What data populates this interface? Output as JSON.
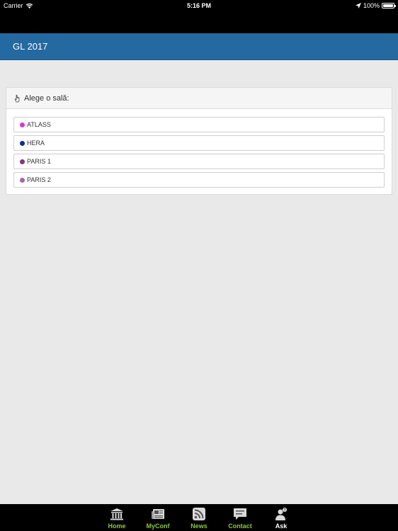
{
  "status_bar": {
    "carrier": "Carrier",
    "time": "5:16 PM",
    "battery": "100%",
    "battery_level": 1.0
  },
  "header": {
    "title": "GL 2017"
  },
  "panel": {
    "prompt": "Alege o sală:",
    "rooms": [
      {
        "label": "ATLASS",
        "color": "#d638d6"
      },
      {
        "label": "HERA",
        "color": "#142c8a"
      },
      {
        "label": "PARIS 1",
        "color": "#7b3a7f"
      },
      {
        "label": "PARIS 2",
        "color": "#a764a8"
      }
    ]
  },
  "tabs": [
    {
      "label": "Home",
      "icon": "bank-icon"
    },
    {
      "label": "MyConf",
      "icon": "newspaper-icon"
    },
    {
      "label": "News",
      "icon": "rss-icon"
    },
    {
      "label": "Contact",
      "icon": "chat-icon"
    },
    {
      "label": "Ask",
      "icon": "user-question-icon"
    }
  ],
  "colors": {
    "header": "#2469a0",
    "tab_label": "#8cc63f",
    "tab_label_active": "#ffffff"
  }
}
